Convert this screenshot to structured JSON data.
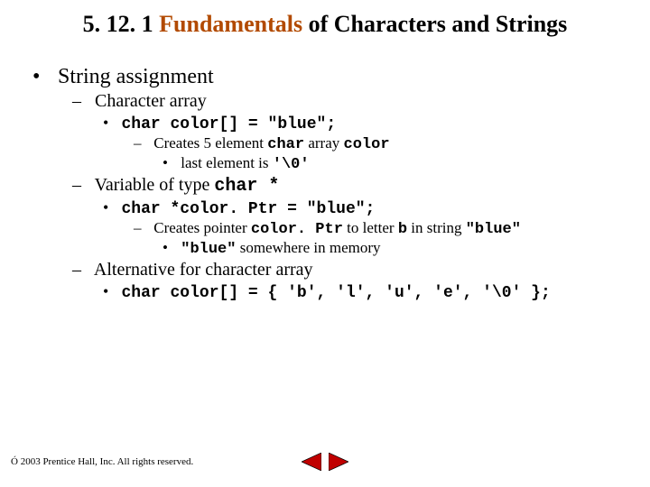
{
  "title": {
    "part1": "5. 12. 1 ",
    "part2": "Fundamentals",
    "part3": " of Characters and Strings"
  },
  "bullets": {
    "b1": "String assignment",
    "b1_1": "Character array",
    "b1_1_1": "char color[] = \"blue\";",
    "b1_1_1_1_pre": "Creates 5 element ",
    "b1_1_1_1_c1": "char",
    "b1_1_1_1_mid": " array ",
    "b1_1_1_1_c2": "color",
    "b1_1_1_1_1_pre": "last element is ",
    "b1_1_1_1_1_c": "'\\0'",
    "b1_2_pre": "Variable of type ",
    "b1_2_c": "char *",
    "b1_2_1": "char *color. Ptr = \"blue\";",
    "b1_2_1_1_pre": "Creates pointer ",
    "b1_2_1_1_c1": "color. Ptr",
    "b1_2_1_1_mid": " to letter ",
    "b1_2_1_1_c2": "b",
    "b1_2_1_1_post": " in string ",
    "b1_2_1_1_q": "\"blue\"",
    "b1_2_1_1_1_q": "\"blue\"",
    "b1_2_1_1_1_post": " somewhere in memory",
    "b1_3": "Alternative for character array",
    "b1_3_1": "char color[] = { 'b', 'l', 'u', 'e', '\\0' };"
  },
  "footer": "Ó 2003 Prentice Hall, Inc. All rights reserved."
}
